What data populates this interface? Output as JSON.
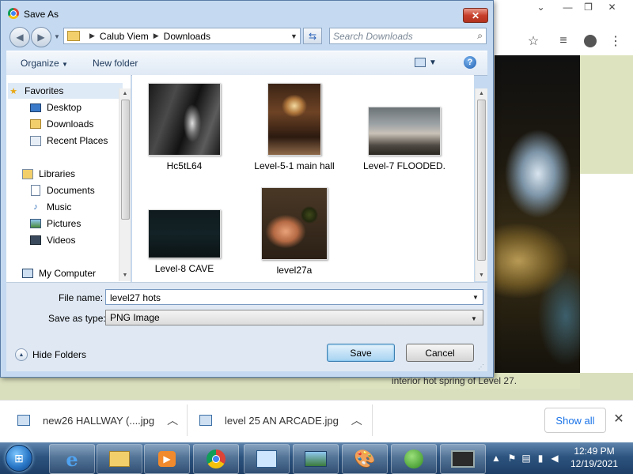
{
  "dialog": {
    "title": "Save As",
    "breadcrumb": [
      "Calub Viem",
      "Downloads"
    ],
    "search_placeholder": "Search Downloads",
    "toolbar": {
      "organize": "Organize",
      "new_folder": "New folder"
    },
    "nav": {
      "favorites": "Favorites",
      "desktop": "Desktop",
      "downloads": "Downloads",
      "recent_places": "Recent Places",
      "libraries": "Libraries",
      "documents": "Documents",
      "music": "Music",
      "pictures": "Pictures",
      "videos": "Videos",
      "my_computer": "My Computer"
    },
    "files": [
      {
        "name": "Hc5tL64"
      },
      {
        "name": "Level-5-1 main hall"
      },
      {
        "name": "Level-7 FLOODED."
      },
      {
        "name": "Level-8 CAVE"
      },
      {
        "name": "level27a"
      }
    ],
    "file_name_label": "File name:",
    "file_name_value": "level27 hots",
    "save_type_label": "Save as type:",
    "save_type_value": "PNG Image",
    "hide_folders": "Hide Folders",
    "save_button": "Save",
    "cancel_button": "Cancel"
  },
  "browser": {
    "caption": "interior hot spring of Level 27."
  },
  "downloads_bar": {
    "items": [
      {
        "name": "new26 HALLWAY (....jpg"
      },
      {
        "name": "level 25 AN ARCADE.jpg"
      }
    ],
    "show_all": "Show all"
  },
  "taskbar": {
    "time": "12:49 PM",
    "date": "12/19/2021"
  },
  "colors": {
    "dialog_frame": "#c5daf0",
    "taskbar": "#2d5580",
    "show_all_link": "#1a73e8"
  },
  "icons": [
    "chrome-icon",
    "close-icon",
    "back-arrow-icon",
    "forward-arrow-icon",
    "folder-icon",
    "refresh-icon",
    "search-icon",
    "view-icon",
    "help-icon",
    "star-icon",
    "desktop-icon",
    "downloads-folder-icon",
    "recent-places-icon",
    "libraries-icon",
    "documents-icon",
    "music-icon",
    "pictures-icon",
    "videos-icon",
    "computer-icon",
    "internet-explorer-icon",
    "file-explorer-icon",
    "media-player-icon",
    "chrome-taskbar-icon",
    "windows-media-center-icon",
    "paint-icon"
  ]
}
